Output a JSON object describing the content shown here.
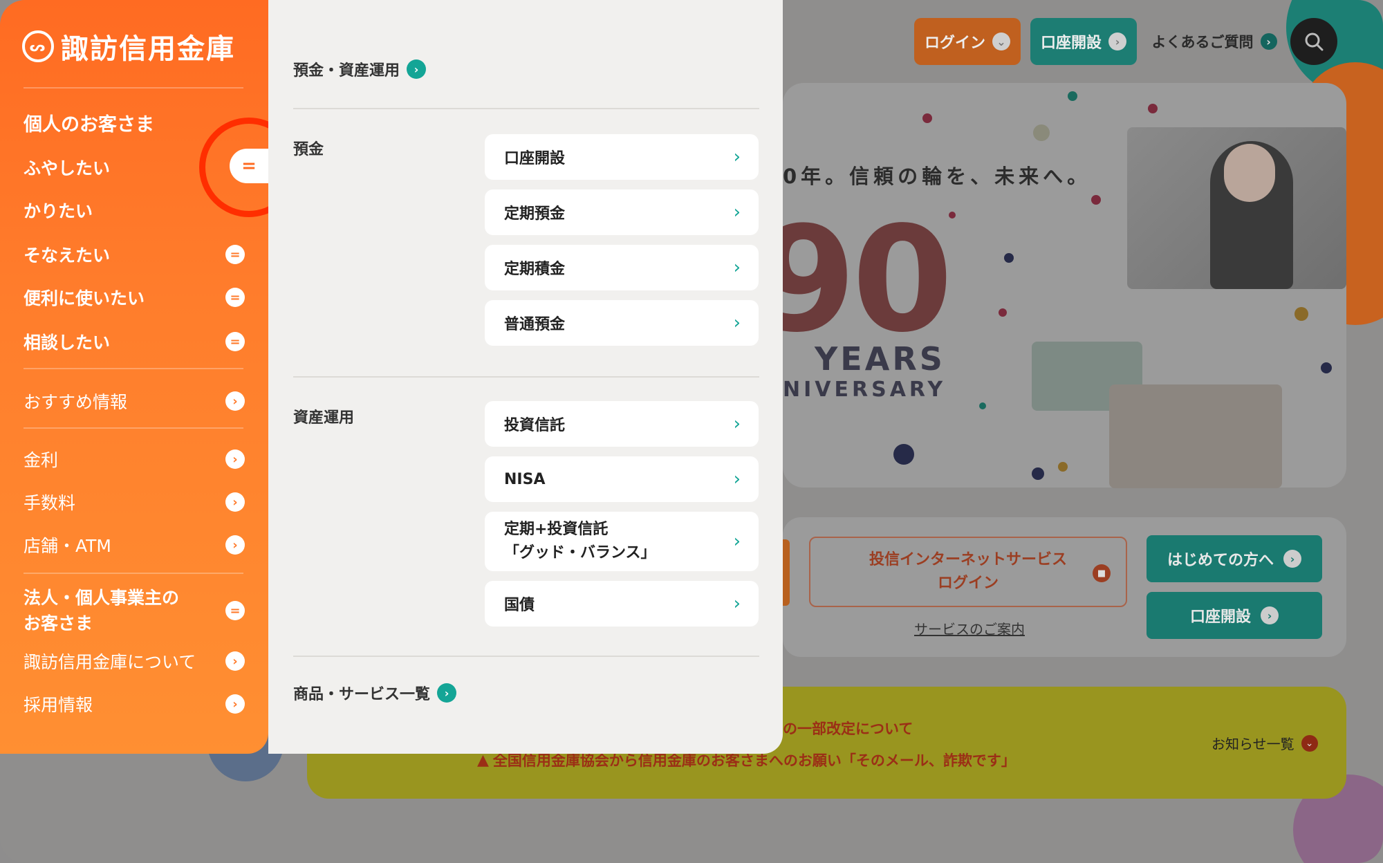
{
  "header": {
    "login_label": "ログイン",
    "account_open_label": "口座開設",
    "faq_label": "よくあるご質問"
  },
  "hero": {
    "tagline": "0年。信頼の輪を、未来へ。",
    "anniversary_number": "90",
    "years_label": "YEARS",
    "anniversary_label": "NIVERSARY"
  },
  "services": {
    "internet_login_line1": "投信インターネットサービス",
    "internet_login_line2": "ログイン",
    "service_guide_link": "サービスのご案内",
    "first_time_label": "はじめての方へ",
    "account_open_label": "口座開設"
  },
  "notices": {
    "notice1": "の一部改定について",
    "notice2": "全国信用金庫協会から信用金庫のお客さまへのお願い「そのメール、詐欺です」",
    "notice_list_label": "お知らせ一覧"
  },
  "sidenav": {
    "logo_text": "諏訪信用金庫",
    "section_title": "個人のお客さま",
    "items": [
      {
        "label": "ふやしたい"
      },
      {
        "label": "かりたい"
      },
      {
        "label": "そなえたい"
      },
      {
        "label": "便利に使いたい"
      },
      {
        "label": "相談したい"
      }
    ],
    "links": [
      {
        "label": "おすすめ情報"
      },
      {
        "label": "金利"
      },
      {
        "label": "手数料"
      },
      {
        "label": "店舗・ATM"
      }
    ],
    "corporate_line1": "法人・個人事業主の",
    "corporate_line2": "お客さま",
    "about_label": "諏訪信用金庫について",
    "recruit_label": "採用情報"
  },
  "panel": {
    "top_link": "預金・資産運用",
    "deposits_label": "預金",
    "deposits_items": [
      "口座開設",
      "定期預金",
      "定期積金",
      "普通預金"
    ],
    "investment_label": "資産運用",
    "investment_items": [
      "投資信託",
      "NISA",
      "国債"
    ],
    "balance_fund_line1": "定期+投資信託",
    "balance_fund_line2": "「グッド・バランス」",
    "all_products_link": "商品・サービス一覧"
  }
}
